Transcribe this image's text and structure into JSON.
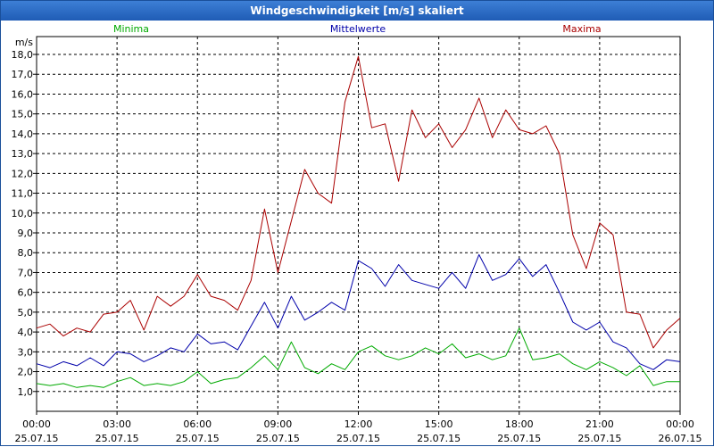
{
  "window": {
    "title": "Windgeschwindigkeit [m/s] skaliert"
  },
  "colors": {
    "minima": "#00aa00",
    "mittel": "#0000aa",
    "maxima": "#aa0000",
    "titlebar": "#2a6bc6"
  },
  "chart_data": {
    "type": "line",
    "title": "Windgeschwindigkeit [m/s] skaliert",
    "ylabel": "m/s",
    "ylim": [
      0,
      18.9
    ],
    "yticks": [
      "1,0",
      "2,0",
      "3,0",
      "4,0",
      "5,0",
      "6,0",
      "7,0",
      "8,0",
      "9,0",
      "10,0",
      "11,0",
      "12,0",
      "13,0",
      "14,0",
      "15,0",
      "16,0",
      "17,0",
      "18,0"
    ],
    "xticks": [
      {
        "time": "00:00",
        "date": "25.07.15"
      },
      {
        "time": "03:00",
        "date": "25.07.15"
      },
      {
        "time": "06:00",
        "date": "25.07.15"
      },
      {
        "time": "09:00",
        "date": "25.07.15"
      },
      {
        "time": "12:00",
        "date": "25.07.15"
      },
      {
        "time": "15:00",
        "date": "25.07.15"
      },
      {
        "time": "18:00",
        "date": "25.07.15"
      },
      {
        "time": "21:00",
        "date": "25.07.15"
      },
      {
        "time": "00:00",
        "date": "26.07.15"
      }
    ],
    "grid": true,
    "legend_placement": "top",
    "series": [
      {
        "name": "Minima",
        "color": "#00aa00",
        "hours": [
          0,
          0.5,
          1,
          1.5,
          2,
          2.5,
          3,
          3.5,
          4,
          4.5,
          5,
          5.5,
          6,
          6.5,
          7,
          7.5,
          8,
          8.5,
          9,
          9.5,
          10,
          10.5,
          11,
          11.5,
          12,
          12.5,
          13,
          13.5,
          14,
          14.5,
          15,
          15.5,
          16,
          16.5,
          17,
          17.5,
          18,
          18.5,
          19,
          19.5,
          20,
          20.5,
          21,
          21.5,
          22,
          22.5,
          23,
          23.5,
          24
        ],
        "values": [
          1.4,
          1.3,
          1.4,
          1.2,
          1.3,
          1.2,
          1.5,
          1.7,
          1.3,
          1.4,
          1.3,
          1.5,
          2.0,
          1.4,
          1.6,
          1.7,
          2.2,
          2.8,
          2.1,
          3.5,
          2.2,
          1.9,
          2.4,
          2.1,
          3.0,
          3.3,
          2.8,
          2.6,
          2.8,
          3.2,
          2.9,
          3.4,
          2.7,
          2.9,
          2.6,
          2.8,
          4.2,
          2.6,
          2.7,
          2.9,
          2.4,
          2.1,
          2.5,
          2.2,
          1.8,
          2.3,
          1.3,
          1.5,
          1.5
        ]
      },
      {
        "name": "Mittelwerte",
        "color": "#0000aa",
        "hours": [
          0,
          0.5,
          1,
          1.5,
          2,
          2.5,
          3,
          3.5,
          4,
          4.5,
          5,
          5.5,
          6,
          6.5,
          7,
          7.5,
          8,
          8.5,
          9,
          9.5,
          10,
          10.5,
          11,
          11.5,
          12,
          12.5,
          13,
          13.5,
          14,
          14.5,
          15,
          15.5,
          16,
          16.5,
          17,
          17.5,
          18,
          18.5,
          19,
          19.5,
          20,
          20.5,
          21,
          21.5,
          22,
          22.5,
          23,
          23.5,
          24
        ],
        "values": [
          2.4,
          2.2,
          2.5,
          2.3,
          2.7,
          2.3,
          3.0,
          2.9,
          2.5,
          2.8,
          3.2,
          3.0,
          3.9,
          3.4,
          3.5,
          3.1,
          4.3,
          5.5,
          4.2,
          5.8,
          4.6,
          5.0,
          5.5,
          5.1,
          7.6,
          7.2,
          6.3,
          7.4,
          6.6,
          6.4,
          6.2,
          7.0,
          6.2,
          7.9,
          6.6,
          6.9,
          7.7,
          6.8,
          7.4,
          6.0,
          4.5,
          4.1,
          4.5,
          3.5,
          3.2,
          2.4,
          2.1,
          2.6,
          2.5
        ]
      },
      {
        "name": "Maxima",
        "color": "#aa0000",
        "hours": [
          0,
          0.5,
          1,
          1.5,
          2,
          2.5,
          3,
          3.5,
          4,
          4.5,
          5,
          5.5,
          6,
          6.5,
          7,
          7.5,
          8,
          8.5,
          9,
          9.5,
          10,
          10.5,
          11,
          11.5,
          12,
          12.5,
          13,
          13.5,
          14,
          14.5,
          15,
          15.5,
          16,
          16.5,
          17,
          17.5,
          18,
          18.5,
          19,
          19.5,
          20,
          20.5,
          21,
          21.5,
          22,
          22.5,
          23,
          23.5,
          24
        ],
        "values": [
          4.2,
          4.4,
          3.8,
          4.2,
          4.0,
          4.9,
          5.0,
          5.6,
          4.1,
          5.8,
          5.3,
          5.8,
          6.9,
          5.8,
          5.6,
          5.1,
          6.6,
          10.2,
          7.0,
          9.6,
          12.2,
          11.0,
          10.5,
          15.6,
          17.9,
          14.3,
          14.5,
          11.6,
          15.2,
          13.8,
          14.5,
          13.3,
          14.2,
          15.8,
          13.8,
          15.2,
          14.2,
          14.0,
          14.4,
          13.0,
          8.9,
          7.2,
          9.5,
          8.9,
          5.0,
          4.9,
          3.2,
          4.1,
          4.7
        ]
      }
    ]
  }
}
